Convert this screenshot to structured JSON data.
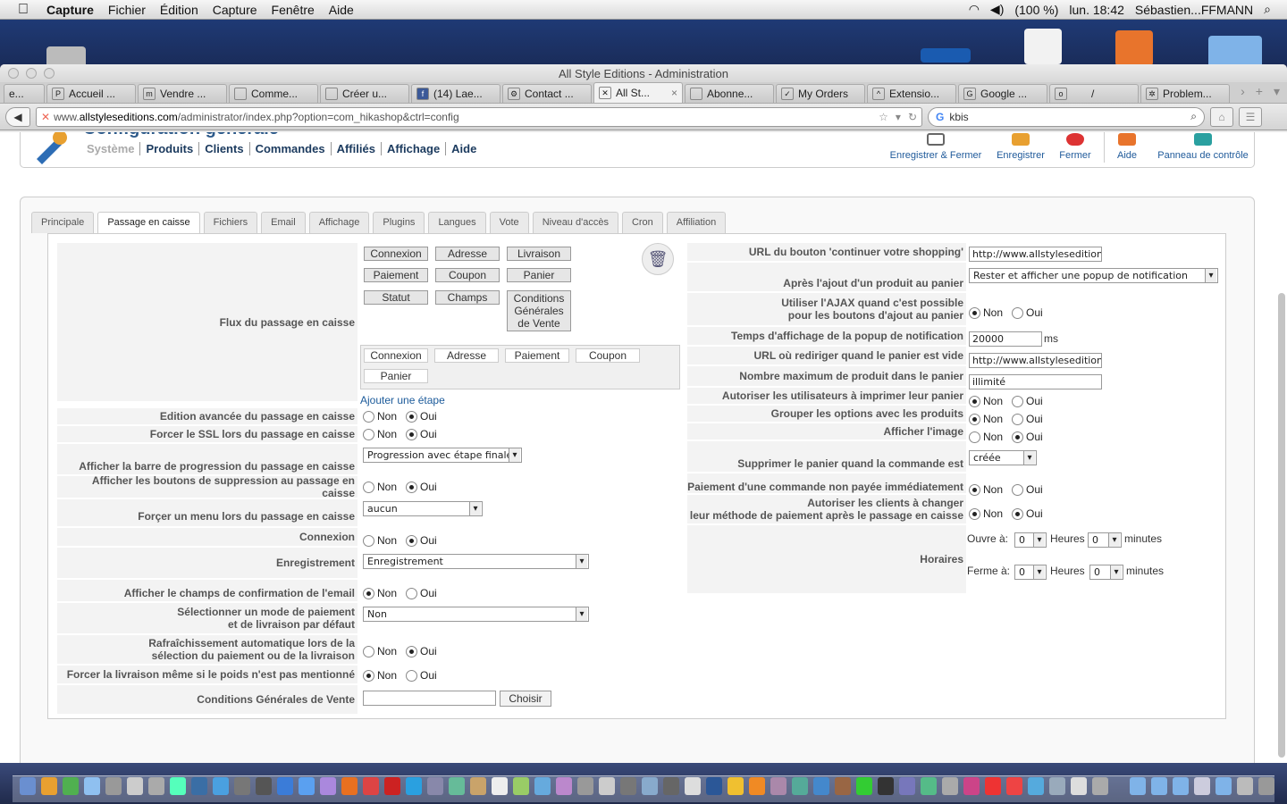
{
  "menubar": {
    "app": "Capture",
    "items": [
      "Fichier",
      "Édition",
      "Capture",
      "Fenêtre",
      "Aide"
    ],
    "battery": "(100 %)",
    "clock": "lun. 18:42",
    "user": "Sébastien...FFMANN"
  },
  "window": {
    "title": "All Style Editions - Administration"
  },
  "tabs": [
    {
      "label": "e..."
    },
    {
      "label": "Accueil ..."
    },
    {
      "label": "Vendre ..."
    },
    {
      "label": "Comme..."
    },
    {
      "label": "Créer u..."
    },
    {
      "label": "(14) Lae..."
    },
    {
      "label": "Contact ..."
    },
    {
      "label": "All St..."
    },
    {
      "label": "Abonne..."
    },
    {
      "label": "My Orders"
    },
    {
      "label": "Extensio..."
    },
    {
      "label": "Google ..."
    },
    {
      "label": "/"
    },
    {
      "label": "Problem..."
    }
  ],
  "nav": {
    "url_prefix": "www.",
    "url_host": "allstyleseditions.com",
    "url_path": "/administrator/index.php?option=com_hikashop&ctrl=config",
    "search_value": "kbis"
  },
  "header": {
    "title": "Configuration générale",
    "menu": [
      "Système",
      "Produits",
      "Clients",
      "Commandes",
      "Affiliés",
      "Affichage",
      "Aide"
    ],
    "toolbar": {
      "save_close": "Enregistrer & Fermer",
      "save": "Enregistrer",
      "close": "Fermer",
      "help": "Aide",
      "control_panel": "Panneau de contrôle"
    }
  },
  "config_tabs": [
    "Principale",
    "Passage en caisse",
    "Fichiers",
    "Email",
    "Affichage",
    "Plugins",
    "Langues",
    "Vote",
    "Niveau d'accès",
    "Cron",
    "Affiliation"
  ],
  "left": {
    "flow_label": "Flux du passage en caisse",
    "flow_palette": [
      "Connexion",
      "Adresse",
      "Livraison",
      "Paiement",
      "Coupon",
      "Panier",
      "Statut",
      "Champs",
      "Conditions Générales de Vente"
    ],
    "flow_steps": [
      "Connexion",
      "Adresse",
      "Paiement",
      "Coupon",
      "Panier"
    ],
    "add_step": "Ajouter une étape",
    "rows": {
      "advanced": "Edition avancée du passage en caisse",
      "ssl": "Forcer le SSL lors du passage en caisse",
      "progress": "Afficher la barre de progression du passage en caisse",
      "progress_value": "Progression avec étape finale",
      "delete_buttons": "Afficher les boutons de suppression au passage en caisse",
      "force_menu": "Forçer un menu lors du passage en caisse",
      "force_menu_value": "aucun",
      "login": "Connexion",
      "registration": "Enregistrement",
      "registration_value": "Enregistrement",
      "email_confirm": "Afficher le champs de confirmation de l'email",
      "default_method_1": "Sélectionner un mode de paiement",
      "default_method_2": "et de livraison par défaut",
      "default_method_value": "Non",
      "auto_refresh_1": "Rafraîchissement automatique lors de la",
      "auto_refresh_2": "sélection du paiement ou de la livraison",
      "force_shipping": "Forcer la livraison même si le poids n'est pas mentionné",
      "terms": "Conditions Générales de Vente",
      "choose": "Choisir"
    }
  },
  "right": {
    "rows": {
      "continue_url": "URL du bouton 'continuer votre shopping'",
      "continue_url_value": "http://www.allstyleseditions",
      "after_add": "Après l'ajout d'un produit au panier",
      "after_add_value": "Rester et afficher une popup de notification",
      "ajax_1": "Utiliser l'AJAX quand c'est possible",
      "ajax_2": "pour les boutons d'ajout au panier",
      "popup_time": "Temps d'affichage de la popup de notification",
      "popup_time_value": "20000",
      "popup_unit": "ms",
      "empty_url": "URL où rediriger quand le panier est vide",
      "empty_url_value": "http://www.allstyleseditions",
      "max_products": "Nombre maximum de produit dans le panier",
      "max_products_value": "illimité",
      "print_cart": "Autoriser les utilisateurs à imprimer leur panier",
      "group_options": "Grouper les options avec les produits",
      "show_image": "Afficher l'image",
      "delete_cart": "Supprimer le panier quand la commande est",
      "delete_cart_value": "créée",
      "unpaid": "Paiement d'une commande non payée immédiatement",
      "change_payment_1": "Autoriser les clients à changer",
      "change_payment_2": "leur méthode de paiement après le passage en caisse",
      "hours": "Horaires",
      "opens": "Ouvre à:",
      "closes": "Ferme à:",
      "heures": "Heures",
      "minutes": "minutes",
      "zero": "0"
    }
  },
  "radio": {
    "non": "Non",
    "oui": "Oui"
  }
}
